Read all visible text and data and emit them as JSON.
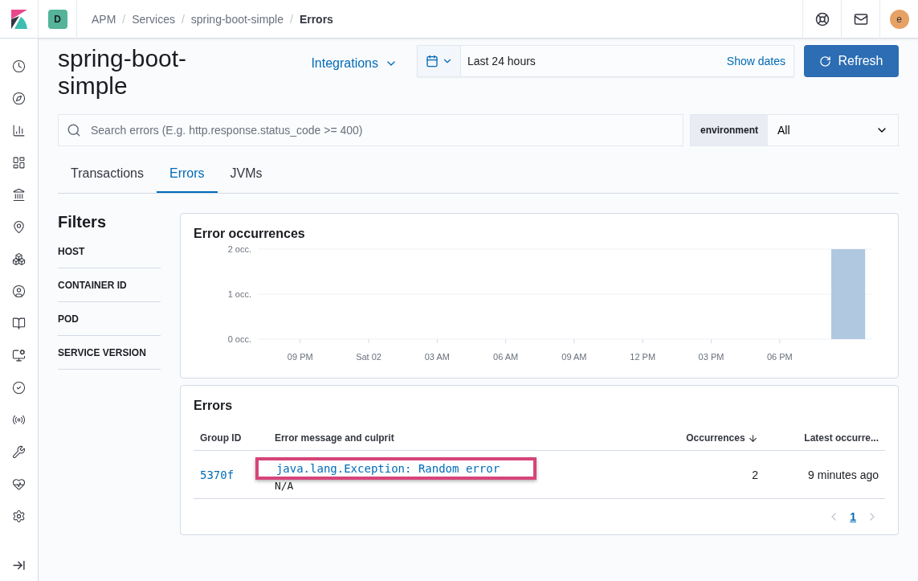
{
  "header": {
    "space_badge": "D",
    "breadcrumbs": [
      {
        "label": "APM",
        "current": false
      },
      {
        "label": "Services",
        "current": false,
        "separator": "/"
      },
      {
        "label": "spring-boot-simple",
        "current": false,
        "separator": "/"
      },
      {
        "label": "Errors",
        "current": true,
        "separator": "/"
      }
    ],
    "avatar": "e"
  },
  "page": {
    "title": "spring-boot-simple",
    "integrations": "Integrations",
    "date_range": "Last 24 hours",
    "show_dates": "Show dates",
    "refresh": "Refresh"
  },
  "search": {
    "placeholder": "Search errors (E.g. http.response.status_code >= 400)"
  },
  "environment": {
    "label": "environment",
    "value": "All"
  },
  "tabs": [
    {
      "label": "Transactions",
      "selected": false
    },
    {
      "label": "Errors",
      "selected": true
    },
    {
      "label": "JVMs",
      "selected": false
    }
  ],
  "filters": {
    "title": "Filters",
    "items": [
      "HOST",
      "CONTAINER ID",
      "POD",
      "SERVICE VERSION"
    ]
  },
  "chart_panel": {
    "title": "Error occurrences",
    "chart_data": {
      "type": "bar",
      "categories": [
        "09 PM",
        "Sat 02",
        "03 AM",
        "06 AM",
        "09 AM",
        "12 PM",
        "03 PM",
        "06 PM",
        null
      ],
      "series": [
        {
          "color": "#b0c9e0",
          "values": [
            0,
            0,
            0,
            0,
            0,
            0,
            0,
            0,
            2
          ]
        }
      ],
      "ylim": [
        0,
        2
      ],
      "yticks": [
        {
          "value": 0,
          "label": "0 occ."
        },
        {
          "value": 1,
          "label": "1 occ."
        },
        {
          "value": 2,
          "label": "2 occ."
        }
      ]
    }
  },
  "errors": {
    "title": "Errors",
    "columns": [
      {
        "label": "Group ID",
        "sorted": false
      },
      {
        "label": "Error message and culprit",
        "sorted": false
      },
      {
        "label": "Occurrences",
        "sorted": true
      },
      {
        "label": "Latest occurre...",
        "sorted": false
      }
    ],
    "rows": [
      {
        "group_id": "5370f",
        "message": "java.lang.Exception: Random error",
        "culprit": "N/A",
        "highlighted": true,
        "occurrences": "2",
        "latest": "9 minutes ago"
      }
    ],
    "pages": [
      {
        "label": "1",
        "selected": true
      }
    ]
  }
}
